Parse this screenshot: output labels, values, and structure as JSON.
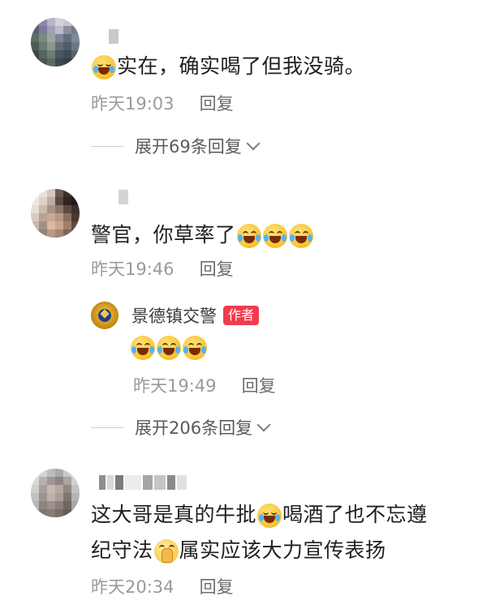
{
  "comments": [
    {
      "text_before": "",
      "text_after": "实在，确实喝了但我没骑。",
      "time": "昨天19:03",
      "reply_label": "回复",
      "expand": {
        "label": "展开69条回复"
      }
    },
    {
      "text_before": "警官，你草率了",
      "time": "昨天19:46",
      "reply_label": "回复",
      "author_reply": {
        "name": "景德镇交警",
        "tag": "作者",
        "time": "昨天19:49",
        "reply_label": "回复"
      },
      "expand": {
        "label": "展开206条回复"
      }
    },
    {
      "line1_before": "这大哥是真的牛批",
      "line1_after": "喝酒了也不忘遵",
      "line2_before": "纪守法",
      "line2_after": "属实应该大力宣传表扬",
      "time": "昨天20:34",
      "reply_label": "回复"
    }
  ],
  "icons": {
    "cry_laugh": "face-with-tears-of-joy-icon",
    "rolling_laugh": "rolling-laughing-icon",
    "pleading": "pleading-face-icon",
    "police": "police-badge-icon",
    "chevron": "chevron-down-icon"
  },
  "colors": {
    "author_tag": "#f23b4f",
    "meta_text": "#9a9a9a",
    "body_text": "#1f1f1f"
  }
}
